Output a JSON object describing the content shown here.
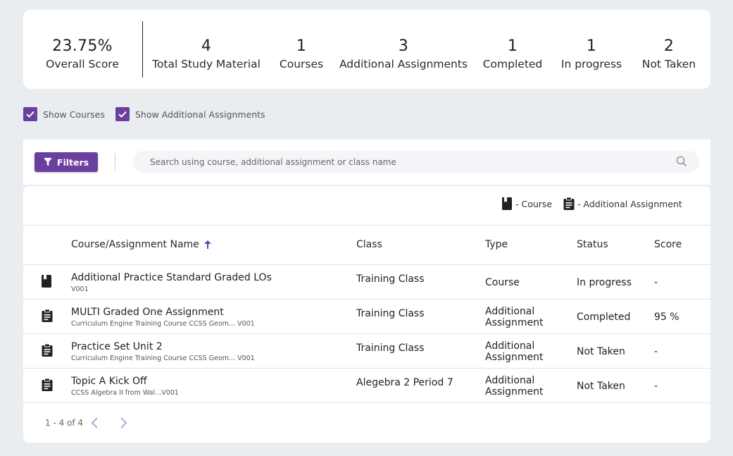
{
  "stats": [
    {
      "value": "23.75%",
      "label": "Overall Score"
    },
    {
      "value": "4",
      "label": "Total Study Material"
    },
    {
      "value": "1",
      "label": "Courses"
    },
    {
      "value": "3",
      "label": "Additional Assignments"
    },
    {
      "value": "1",
      "label": "Completed"
    },
    {
      "value": "1",
      "label": "In progress"
    },
    {
      "value": "2",
      "label": "Not Taken"
    }
  ],
  "checkboxes": {
    "show_courses": {
      "label": "Show Courses",
      "checked": true
    },
    "show_assignments": {
      "label": "Show Additional Assignments",
      "checked": true
    }
  },
  "toolbar": {
    "filters_label": "Filters",
    "search_placeholder": "Search using course, additional assignment or class name"
  },
  "legend": {
    "course_label": "- Course",
    "assignment_label": "- Additional Assignment"
  },
  "table": {
    "headers": {
      "name": "Course/Assignment Name",
      "class": "Class",
      "type": "Type",
      "status": "Status",
      "score": "Score"
    },
    "rows": [
      {
        "icon": "book-icon",
        "name": "Additional Practice Standard Graded LOs",
        "sub": "V001",
        "class": "Training Class",
        "type": "Course",
        "status": "In progress",
        "score": "-"
      },
      {
        "icon": "clipboard-icon",
        "name": "MULTI Graded One Assignment",
        "sub": "Curriculum Engine Training Course CCSS Geom... V001",
        "class": "Training Class",
        "type": "Additional Assignment",
        "status": "Completed",
        "score": "95 %"
      },
      {
        "icon": "clipboard-icon",
        "name": "Practice Set Unit 2",
        "sub": "Curriculum Engine Training Course CCSS Geom... V001",
        "class": "Training Class",
        "type": "Additional Assignment",
        "status": "Not Taken",
        "score": "-"
      },
      {
        "icon": "clipboard-icon",
        "name": "Topic A Kick Off",
        "sub": "CCSS Algebra II from Wal...V001",
        "class": "Alegebra 2 Period 7",
        "type": "Additional Assignment",
        "status": "Not Taken",
        "score": "-"
      }
    ]
  },
  "pagination": {
    "text": "1 - 4 of 4"
  },
  "colors": {
    "accent": "#6b3f9e",
    "background": "#e9edf0"
  }
}
